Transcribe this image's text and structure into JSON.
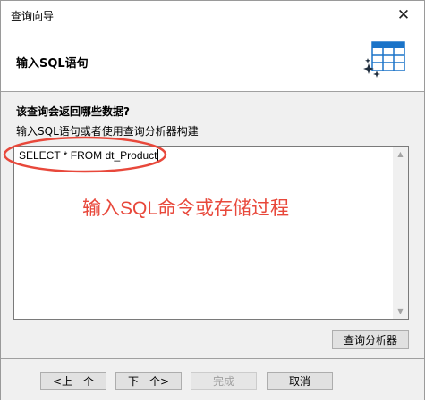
{
  "window": {
    "title": "查询向导",
    "close_glyph": "✕"
  },
  "header": {
    "title": "输入SQL语句",
    "icon": "table-wizard-icon"
  },
  "section": {
    "heading": "该查询会返回哪些数据?",
    "description": "输入SQL语句或者使用查询分析器构建"
  },
  "sql_editor": {
    "value": "SELECT * FROM dt_Product"
  },
  "annotation": {
    "text": "输入SQL命令或存储过程",
    "color": "#e8483b"
  },
  "buttons": {
    "query_analyzer": "查询分析器",
    "prev": "<上一个",
    "next": "下一个>",
    "finish": "完成",
    "cancel": "取消"
  },
  "colors": {
    "accent_blue": "#1a73c8",
    "annotation_red": "#e8483b"
  }
}
